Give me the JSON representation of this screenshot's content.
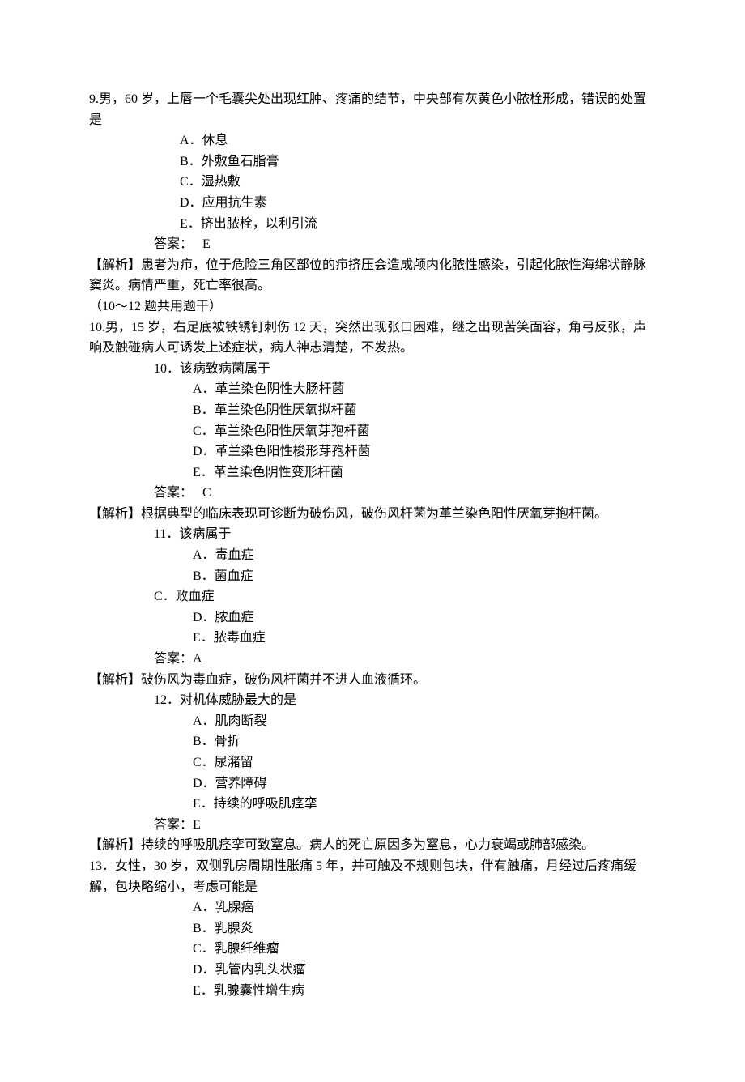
{
  "q9": {
    "stem": "9.男，60 岁，上唇一个毛囊尖处出现红肿、疼痛的结节，中央部有灰黄色小脓栓形成，错误的处置是",
    "A": "A．休息",
    "B": "B．外敷鱼石脂膏",
    "C": "C．湿热敷",
    "D": "D．应用抗生素",
    "E": "E．挤出脓栓，以利引流",
    "ans": "答案：   E",
    "exp": "【解析】患者为疖，位于危险三角区部位的疖挤压会造成颅内化脓性感染，引起化脓性海绵状静脉窦炎。病情严重，死亡率很高。"
  },
  "shared": "（10～12 题共用题干）",
  "stem1012": "10.男，15 岁，右足底被铁锈钉刺伤 12 天，突然出现张口困难，继之出现苦笑面容，角弓反张，声响及触碰病人可诱发上述症状，病人神志清楚，不发热。",
  "q10": {
    "title": "10．该病致病菌属于",
    "A": "A．革兰染色阴性大肠杆菌",
    "B": "B．革兰染色阴性厌氧拟杆菌",
    "C": "C．革兰染色阳性厌氧芽孢杆菌",
    "D": "D．革兰染色阳性梭形芽孢杆菌",
    "E": "E．革兰染色阴性变形杆菌",
    "ans": "答案：   C",
    "exp": "【解析】根据典型的临床表现可诊断为破伤风，破伤风杆菌为革兰染色阳性厌氧芽抱杆菌。"
  },
  "q11": {
    "title": "11．该病属于",
    "A": "A．毒血症",
    "B": "B．菌血症",
    "C": "C．败血症",
    "D": "D．脓血症",
    "E": "E．脓毒血症",
    "ans": "答案：A",
    "exp": "【解析】破伤风为毒血症，破伤风杆菌并不进人血液循环。"
  },
  "q12": {
    "title": "12．对机体威胁最大的是",
    "A": "A．肌肉断裂",
    "B": "B．骨折",
    "C": "C．尿潴留",
    "D": "D．营养障碍",
    "E": "E．持续的呼吸肌痉挛",
    "ans": "答案：E",
    "exp": "【解析】持续的呼吸肌痉挛可致窒息。病人的死亡原因多为窒息，心力衰竭或肺部感染。"
  },
  "q13": {
    "stem": "13．女性，30 岁，双侧乳房周期性胀痛 5 年，并可触及不规则包块，伴有触痛，月经过后疼痛缓解，包块略缩小，考虑可能是",
    "A": "A．乳腺癌",
    "B": "B．乳腺炎",
    "C": "C．乳腺纤维瘤",
    "D": "D．乳管内乳头状瘤",
    "E": "E．乳腺囊性增生病"
  }
}
